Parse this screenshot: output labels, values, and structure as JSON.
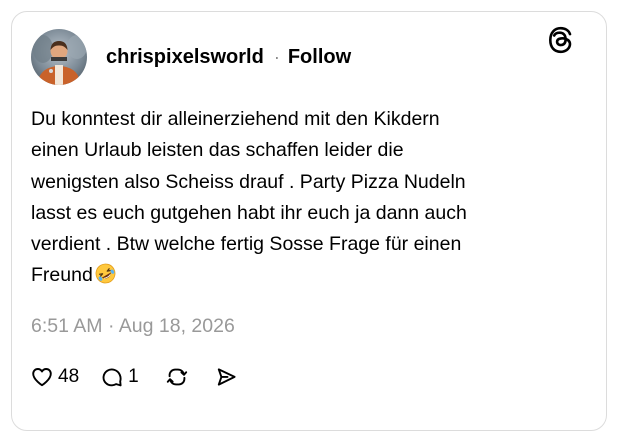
{
  "post": {
    "author": {
      "username": "chrispixelsworld",
      "avatar_icon": "avatar-photo"
    },
    "separator": "·",
    "follow_label": "Follow",
    "brand_icon": "threads-logo-icon",
    "text": "Du konntest dir alleinerziehend mit den Kikdern\neinen Urlaub leisten das schaffen leider die\nwenigsten also Scheiss drauf . Party Pizza Nudeln\nlasst es euch gutgehen habt ihr euch ja dann auch\nverdient . Btw welche fertig Sosse Frage für einen\nFreund",
    "text_emoji": "rolling-on-floor-laughing-emoji",
    "timestamp": "6:51 AM · Aug 18, 2026",
    "actions": {
      "like_count": "48",
      "reply_count": "1",
      "icons": [
        "heart-icon",
        "comment-icon",
        "repost-icon",
        "share-icon"
      ]
    }
  },
  "colors": {
    "text": "#000000",
    "timestamp": "#999999",
    "border": "#dcdcdc",
    "background": "#ffffff"
  }
}
